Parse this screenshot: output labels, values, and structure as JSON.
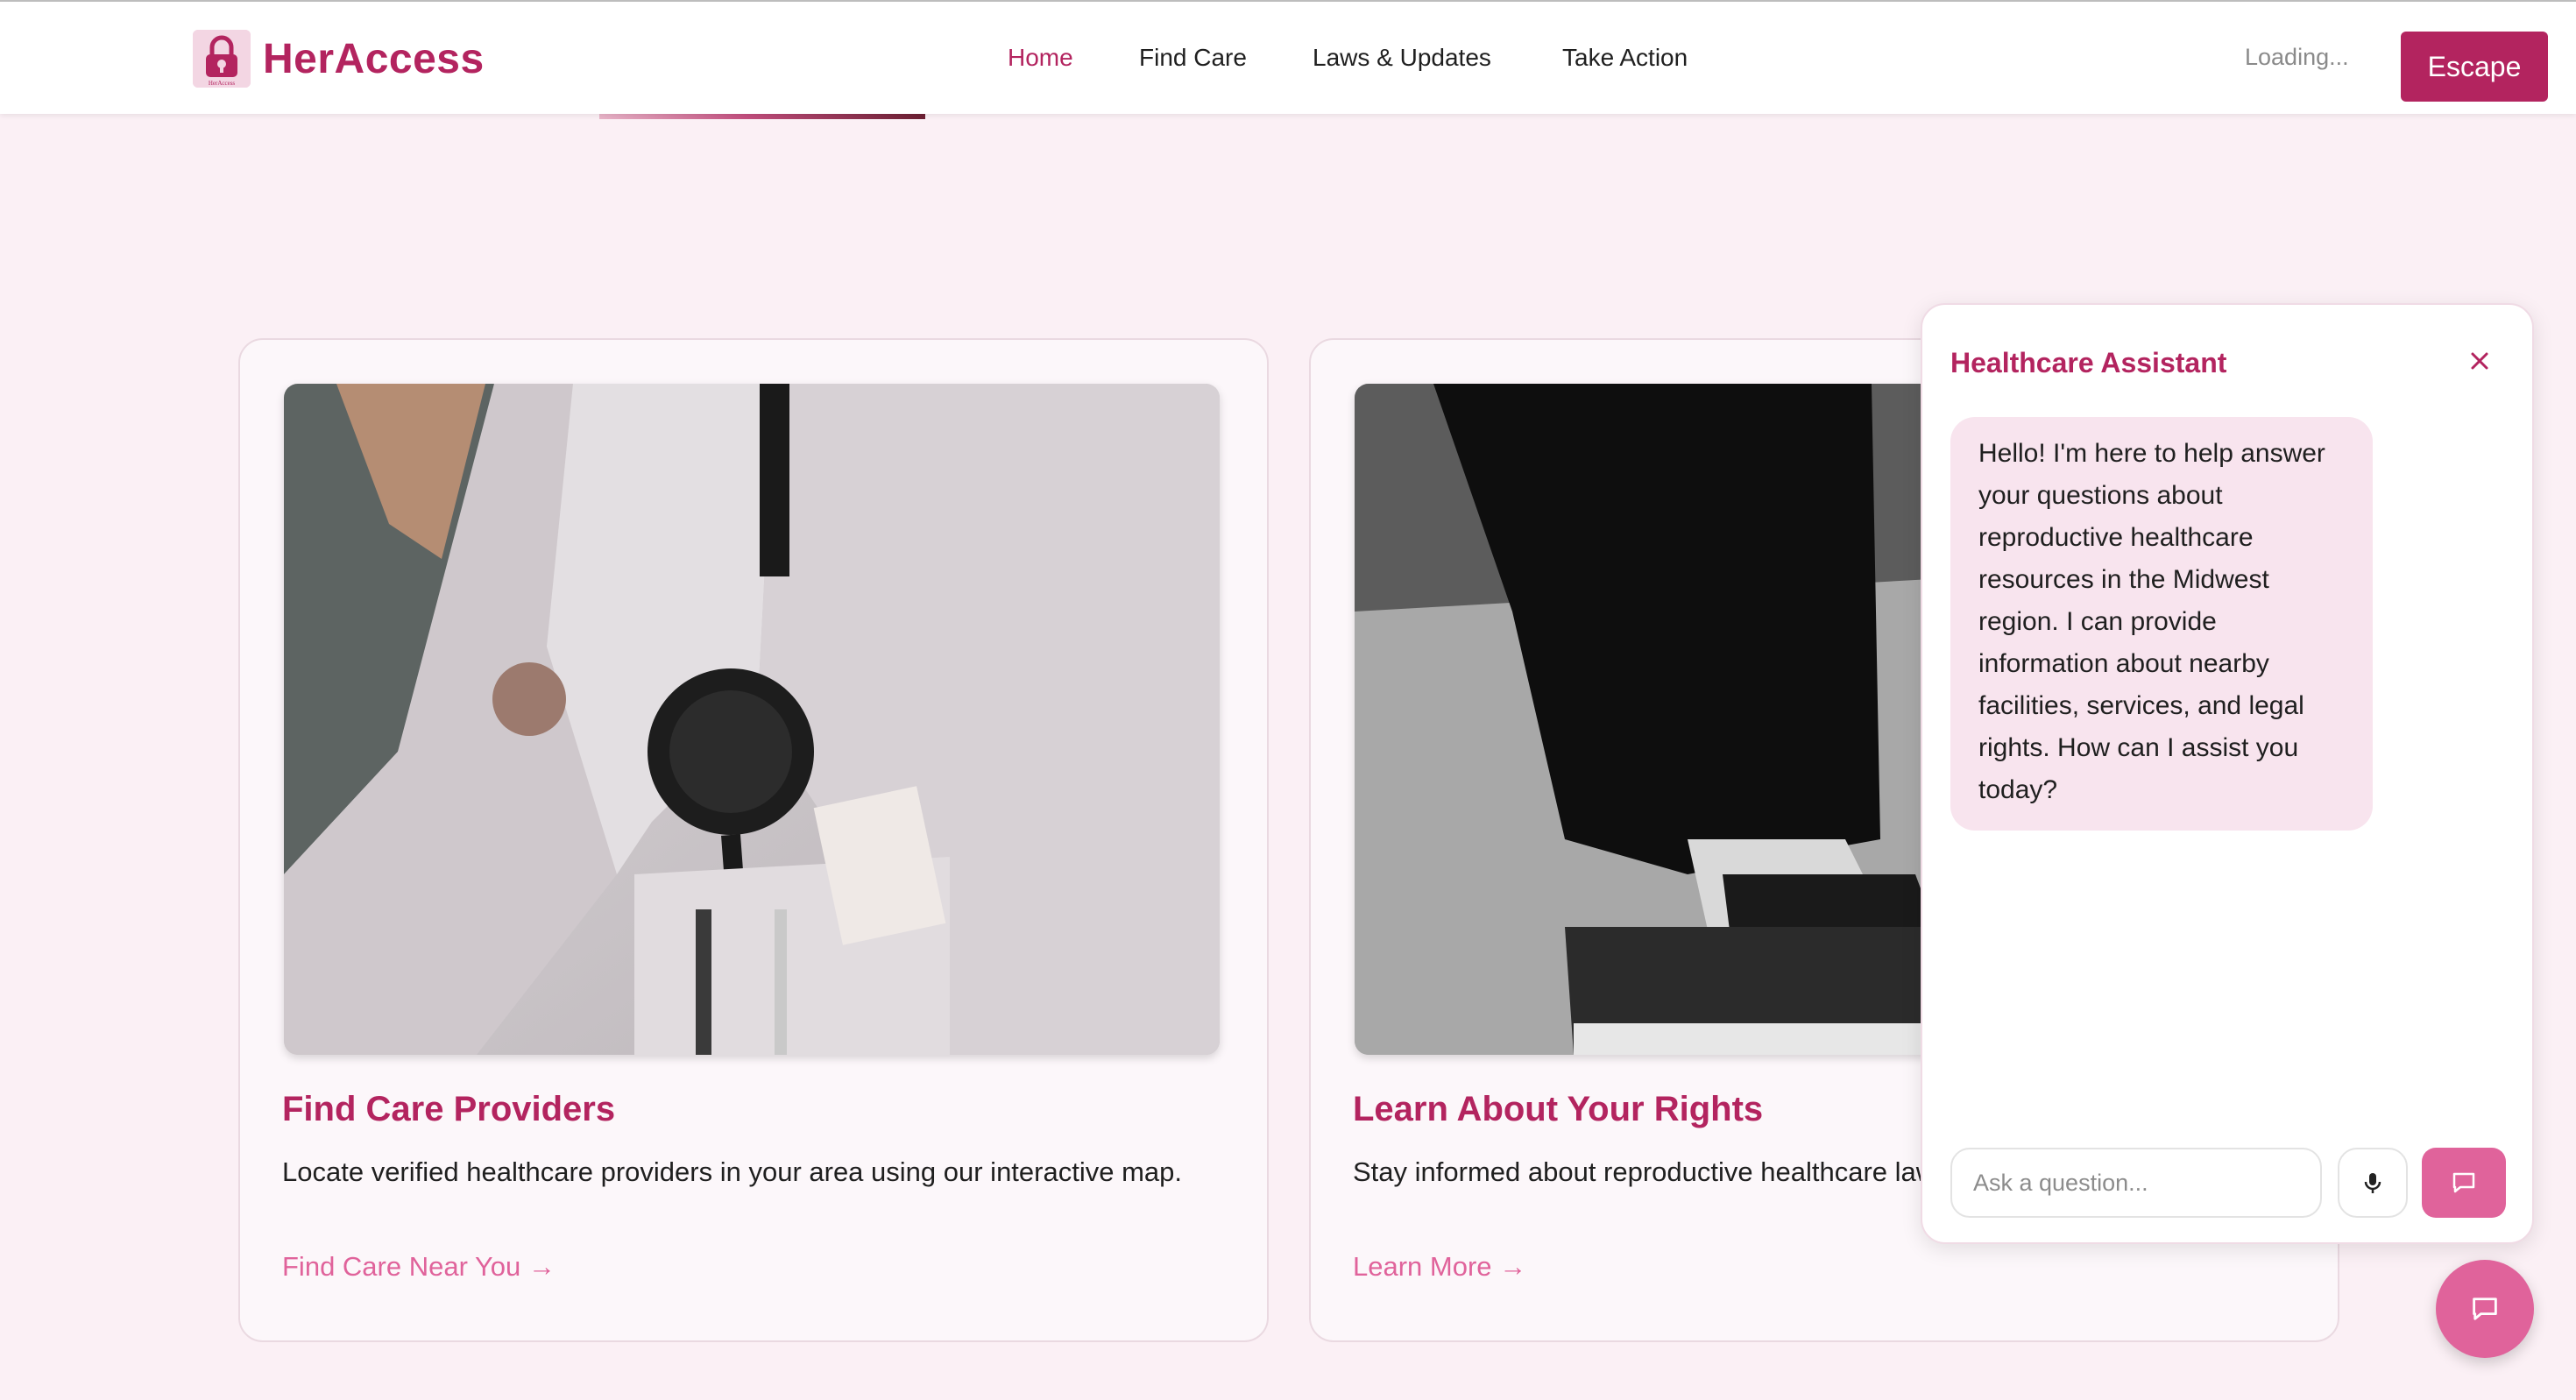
{
  "brand": {
    "name": "HerAccess",
    "logo_caption": "HerAccess",
    "accent_color": "#b3245f",
    "link_color": "#e0639b"
  },
  "nav": {
    "items": [
      {
        "label": "Home",
        "active": true
      },
      {
        "label": "Find Care",
        "active": false
      },
      {
        "label": "Laws & Updates",
        "active": false
      },
      {
        "label": "Take Action",
        "active": false
      }
    ]
  },
  "header": {
    "status_text": "Loading...",
    "escape_label": "Escape"
  },
  "cards": [
    {
      "title": "Find Care Providers",
      "description": "Locate verified healthcare providers in your area using our interactive map.",
      "link_label": "Find Care Near You →",
      "image_icon": "doctor-stethoscope-photo"
    },
    {
      "title": "Learn About Your Rights",
      "description": "Stay informed about reproductive healthcare laws and updates in your state.",
      "link_label": "Learn More →",
      "image_icon": "high-heel-books-photo"
    }
  ],
  "chat": {
    "title": "Healthcare Assistant",
    "close_icon": "close-icon",
    "messages": [
      {
        "from": "assistant",
        "text": "Hello! I'm here to help answer your questions about reproductive healthcare resources in the Midwest region. I can provide information about nearby facilities, services, and legal rights. How can I assist you today?"
      }
    ],
    "input_placeholder": "Ask a question...",
    "mic_icon": "microphone-icon",
    "send_icon": "chat-bubble-icon"
  },
  "fab_icon": "chat-bubble-icon"
}
